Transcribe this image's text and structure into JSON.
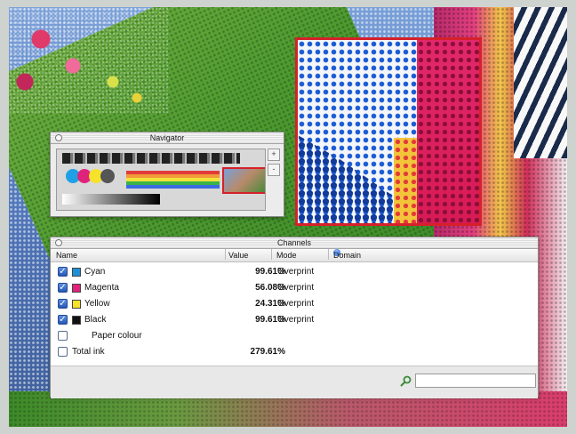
{
  "navigator": {
    "title": "Navigator",
    "zoom_in_label": "+",
    "zoom_out_label": "-"
  },
  "channels": {
    "title": "Channels",
    "columns": {
      "name": "Name",
      "value": "Value",
      "mode": "Mode",
      "domain": "Domain"
    },
    "rows": [
      {
        "label": "Cyan",
        "value": "99.61%",
        "mode": "Overprint",
        "color": "#1e90d6",
        "checked": true
      },
      {
        "label": "Magenta",
        "value": "56.08%",
        "mode": "Overprint",
        "color": "#e0237a",
        "checked": true
      },
      {
        "label": "Yellow",
        "value": "24.31%",
        "mode": "Overprint",
        "color": "#f5e22a",
        "checked": true
      },
      {
        "label": "Black",
        "value": "99.61%",
        "mode": "Overprint",
        "color": "#111111",
        "checked": true
      }
    ],
    "paper_colour_label": "Paper colour",
    "total_ink_label": "Total ink",
    "total_ink_value": "279.61%",
    "search_placeholder": ""
  },
  "colors": {
    "loupe_border": "#d6202a",
    "accent_blue": "#1f5fd6"
  }
}
